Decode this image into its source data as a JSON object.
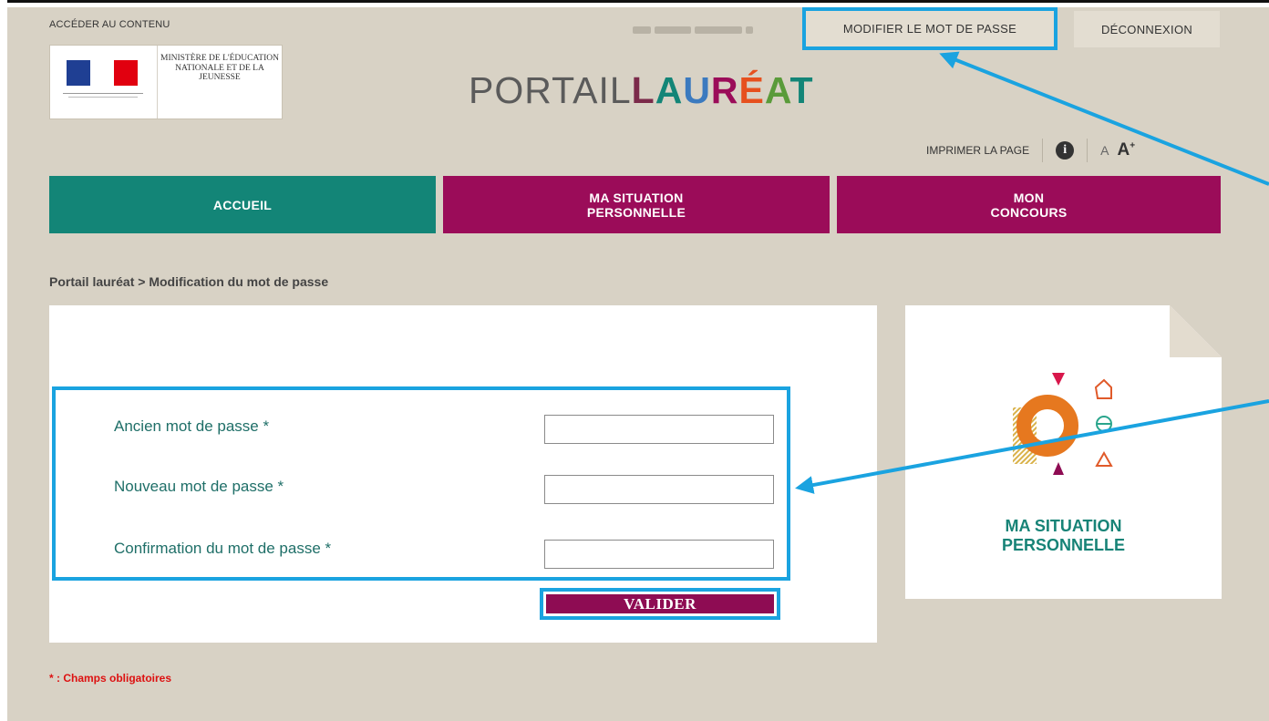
{
  "header": {
    "skip_link": "ACCÉDER AU CONTENU",
    "modify_password": "MODIFIER LE MOT DE PASSE",
    "logout": "DÉCONNEXION",
    "ministry": "MINISTÈRE DE L'ÉDUCATION NATIONALE ET DE LA JEUNESSE",
    "portal_title_part1": "PORTAIL",
    "portal_title_part2_letters": [
      "L",
      "A",
      "U",
      "R",
      "É",
      "A",
      "T"
    ],
    "portal_title_part2_colors": [
      "#7b2a4a",
      "#138577",
      "#3b7abf",
      "#9b0c59",
      "#e6501e",
      "#5a9b3a",
      "#138577"
    ]
  },
  "utility": {
    "print": "IMPRIMER LA PAGE",
    "info_icon": "i",
    "font_decrease": "A",
    "font_increase": "A",
    "font_increase_sup": "+"
  },
  "nav": {
    "accueil": "ACCUEIL",
    "situation_line1": "MA SITUATION",
    "situation_line2": "PERSONNELLE",
    "concours_line1": "MON",
    "concours_line2": "CONCOURS"
  },
  "breadcrumb": "Portail lauréat > Modification du mot de passe",
  "form": {
    "old_password_label": "Ancien mot de passe *",
    "new_password_label": "Nouveau mot de passe *",
    "confirm_password_label": "Confirmation du mot de passe *",
    "old_password_value": "",
    "new_password_value": "",
    "confirm_password_value": "",
    "submit": "VALIDER"
  },
  "required_note": "* : Champs obligatoires",
  "side_card": {
    "title_line1": "MA SITUATION",
    "title_line2": "PERSONNELLE"
  },
  "colors": {
    "teal": "#138577",
    "plum": "#9b0c59",
    "highlight": "#1aa3e0",
    "background": "#d8d2c5",
    "orange": "#e67a2a"
  }
}
